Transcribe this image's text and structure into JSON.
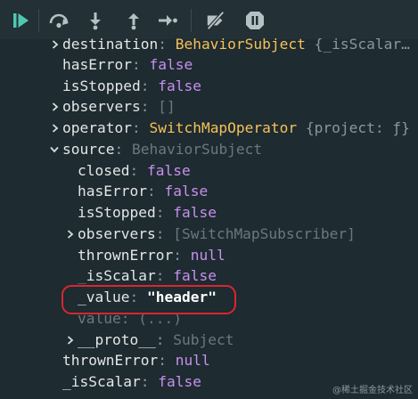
{
  "toolbar": {
    "icons": [
      "resume-icon",
      "step-over-icon",
      "step-into-icon",
      "step-out-icon",
      "step-icon",
      "deactivate-breakpoints-icon",
      "pause-on-exceptions-icon"
    ],
    "accent": "#4ec9b0"
  },
  "tree": {
    "rows": [
      {
        "key": "destination",
        "value": "BehaviorSubject",
        "suffix": "{_isScalar…"
      },
      {
        "key": "hasError",
        "value": "false"
      },
      {
        "key": "isStopped",
        "value": "false"
      },
      {
        "key": "observers",
        "value": "[]"
      },
      {
        "key": "operator",
        "value": "SwitchMapOperator",
        "suffix": "{project: ƒ}"
      },
      {
        "key": "source",
        "value": "BehaviorSubject"
      },
      {
        "key": "closed",
        "value": "false"
      },
      {
        "key": "hasError",
        "value": "false"
      },
      {
        "key": "isStopped",
        "value": "false"
      },
      {
        "key": "observers",
        "value": "[SwitchMapSubscriber]"
      },
      {
        "key": "thrownError",
        "value": "null"
      },
      {
        "key": "isScalar",
        "prefix": "_",
        "value": "false"
      },
      {
        "key": "_value",
        "value": "\"header\""
      },
      {
        "key": "value",
        "value": "(...)"
      },
      {
        "key": "__proto__",
        "value": "Subject"
      },
      {
        "key": "thrownError",
        "value": "null"
      },
      {
        "key": "_isScalar",
        "value": "false"
      }
    ]
  },
  "watermark": "@稀土掘金技术社区"
}
